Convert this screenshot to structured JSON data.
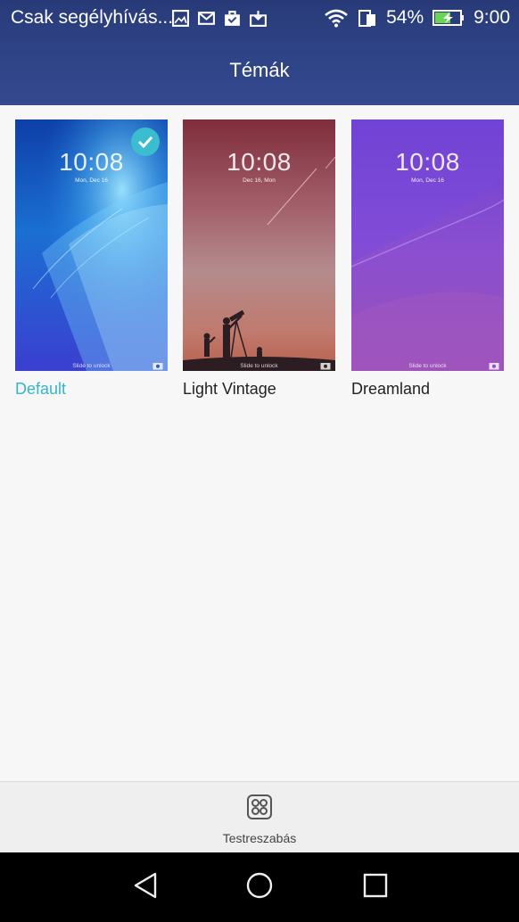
{
  "status_bar": {
    "notification_title": "Csak segélyhívás...",
    "battery_percent": "54%",
    "time": "9:00",
    "icons": [
      "image-icon",
      "mail-icon",
      "shopping-bag-icon",
      "inbox-icon",
      "wifi-icon",
      "sim-icon",
      "battery-charging-icon"
    ]
  },
  "header": {
    "title": "Témák"
  },
  "themes": [
    {
      "name": "Default",
      "selected": true,
      "clock": "10:08",
      "date": "Mon, Dec 16",
      "slide_text": "Slide to unlock"
    },
    {
      "name": "Light Vintage",
      "selected": false,
      "clock": "10:08",
      "date": "Dec 16,  Mon",
      "slide_text": "Slide to unlock"
    },
    {
      "name": "Dreamland",
      "selected": false,
      "clock": "10:08",
      "date": "Mon, Dec 16",
      "slide_text": "Slide to unlock"
    }
  ],
  "bottom_bar": {
    "customize_label": "Testreszabás",
    "icon": "grid-icon"
  },
  "nav_bar": {
    "buttons": [
      "back-icon",
      "home-icon",
      "recents-icon"
    ]
  },
  "colors": {
    "header": "#2f4487",
    "accent": "#35b5c8",
    "background": "#f7f7f7"
  }
}
